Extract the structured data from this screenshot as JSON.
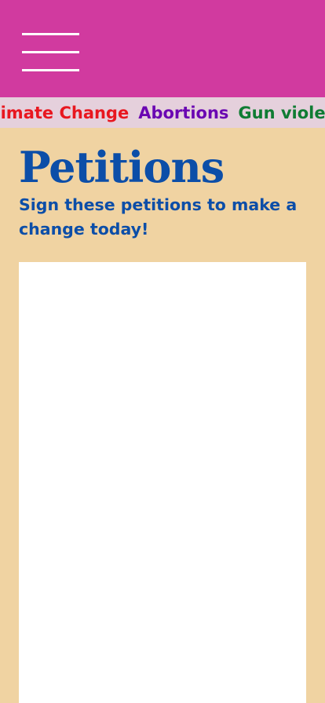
{
  "header": {
    "menu_icon": "hamburger-menu-icon"
  },
  "ticker": {
    "topics": [
      {
        "label": "Climate Change",
        "color": "#e8171f"
      },
      {
        "label": "Abortions",
        "color": "#6a06b2"
      },
      {
        "label": "Gun violence",
        "color": "#0f7c33"
      }
    ]
  },
  "main": {
    "title": "Petitions",
    "subtitle": "Sign these petitions to make a change today!"
  },
  "colors": {
    "header_bg": "#d13a9f",
    "ticker_bg": "#e5d0dc",
    "page_bg": "#f0d3a2",
    "heading": "#0c4ea8"
  }
}
